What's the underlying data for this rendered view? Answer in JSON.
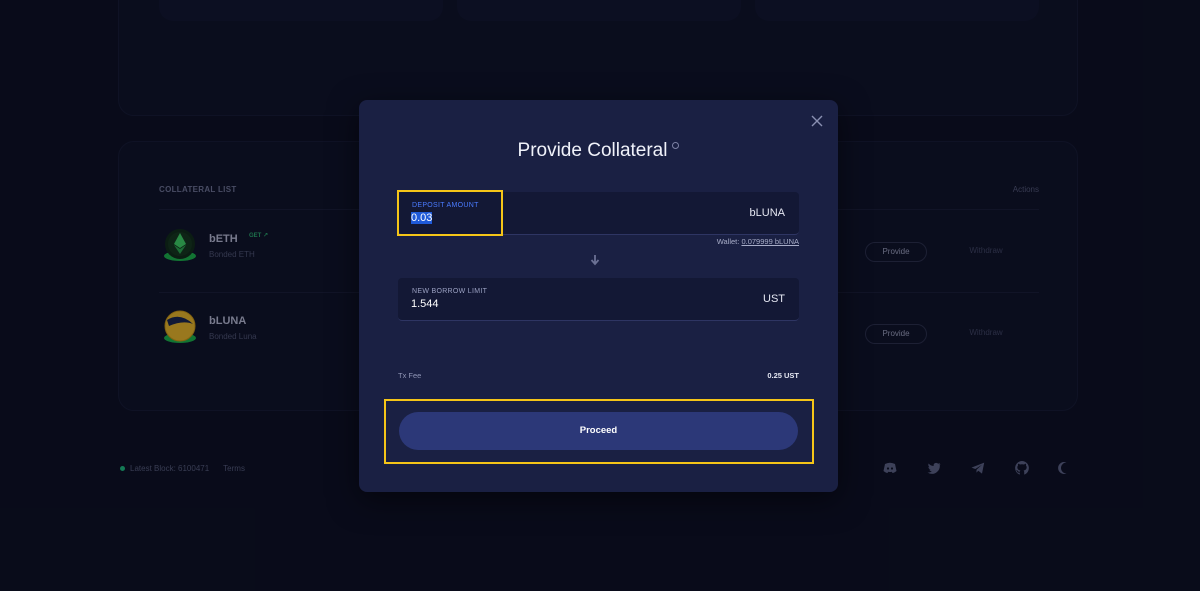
{
  "background": {
    "collateral_list_title": "COLLATERAL LIST",
    "actions_title": "Actions",
    "assets": [
      {
        "name": "bETH",
        "subtitle": "Bonded ETH",
        "badge": "GET ↗",
        "provide": "Provide",
        "withdraw": "Withdraw"
      },
      {
        "name": "bLUNA",
        "subtitle": "Bonded Luna",
        "provide": "Provide",
        "withdraw": "Withdraw"
      }
    ],
    "footer": {
      "latest_block": "Latest Block: 6100471",
      "terms": "Terms"
    },
    "social_icons": [
      "discord-icon",
      "twitter-icon",
      "telegram-icon",
      "github-icon",
      "theme-moon-icon"
    ]
  },
  "modal": {
    "title": "Provide Collateral",
    "deposit": {
      "label": "DEPOSIT AMOUNT",
      "value": "0.03",
      "unit": "bLUNA"
    },
    "wallet": {
      "prefix": "Wallet:",
      "amount": "0.079999 bLUNA"
    },
    "borrow_limit": {
      "label": "NEW BORROW LIMIT",
      "value": "1.544",
      "unit": "UST"
    },
    "tx_fee": {
      "label": "Tx Fee",
      "value": "0.25 UST"
    },
    "proceed_label": "Proceed"
  },
  "colors": {
    "highlight": "#f5c518",
    "accent": "#4a7bff",
    "button": "#2c3878",
    "status_ok": "#1db97a"
  }
}
